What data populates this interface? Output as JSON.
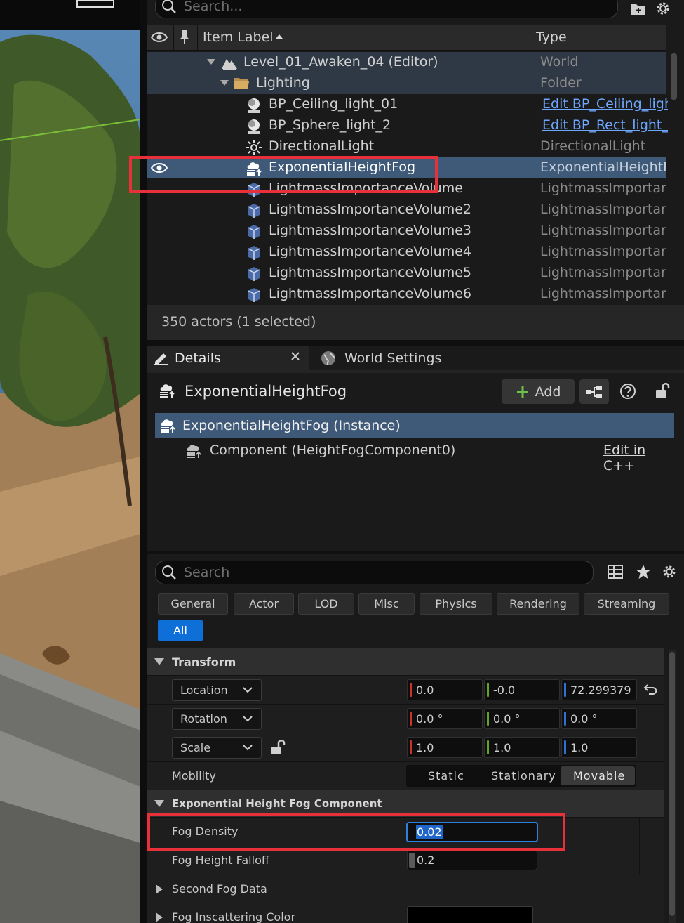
{
  "outliner": {
    "search_placeholder": "Search...",
    "col_label": "Item Label",
    "col_type": "Type",
    "rows": [
      {
        "label": "Level_01_Awaken_04 (Editor)",
        "type": "World"
      },
      {
        "label": "Lighting",
        "type": "Folder"
      },
      {
        "label": "BP_Ceiling_light_01",
        "type": "Edit BP_Ceiling_ligh"
      },
      {
        "label": "BP_Sphere_light_2",
        "type": "Edit BP_Rect_light_("
      },
      {
        "label": "DirectionalLight",
        "type": "DirectionalLight"
      },
      {
        "label": "ExponentialHeightFog",
        "type": "ExponentialHeightFo"
      },
      {
        "label": "LightmassImportanceVolume",
        "type": "LightmassImportanc"
      },
      {
        "label": "LightmassImportanceVolume2",
        "type": "LightmassImportanc"
      },
      {
        "label": "LightmassImportanceVolume3",
        "type": "LightmassImportanc"
      },
      {
        "label": "LightmassImportanceVolume4",
        "type": "LightmassImportanc"
      },
      {
        "label": "LightmassImportanceVolume5",
        "type": "LightmassImportanc"
      },
      {
        "label": "LightmassImportanceVolume6",
        "type": "LightmassImportanc"
      }
    ],
    "status": "350 actors (1 selected)"
  },
  "details": {
    "tab_details": "Details",
    "tab_world_settings": "World Settings",
    "actor_name": "ExponentialHeightFog",
    "add_label": "Add",
    "instance_label": "ExponentialHeightFog (Instance)",
    "component_label": "Component (HeightFogComponent0)",
    "edit_cpp": "Edit in C++",
    "search_placeholder": "Search",
    "categories": [
      "General",
      "Actor",
      "LOD",
      "Misc",
      "Physics",
      "Rendering",
      "Streaming"
    ],
    "all_label": "All",
    "transform": {
      "header": "Transform",
      "location_label": "Location",
      "location": [
        "0.0",
        "-0.0",
        "72.299379"
      ],
      "rotation_label": "Rotation",
      "rotation": [
        "0.0 °",
        "0.0 °",
        "0.0 °"
      ],
      "scale_label": "Scale",
      "scale": [
        "1.0",
        "1.0",
        "1.0"
      ],
      "mobility_label": "Mobility",
      "mobility_options": [
        "Static",
        "Stationary",
        "Movable"
      ],
      "mobility_selected": "Movable"
    },
    "fog": {
      "header": "Exponential Height Fog Component",
      "density_label": "Fog Density",
      "density": "0.02",
      "falloff_label": "Fog Height Falloff",
      "falloff": "0.2",
      "second_label": "Second Fog Data",
      "inscatter_label": "Fog Inscattering Color"
    }
  },
  "colors": {
    "highlight": "#e8303a",
    "selection": "#3f5a78",
    "accent": "#0f6fd8",
    "x_axis": "#c8352b",
    "y_axis": "#62a52a",
    "z_axis": "#2f6fd6"
  }
}
